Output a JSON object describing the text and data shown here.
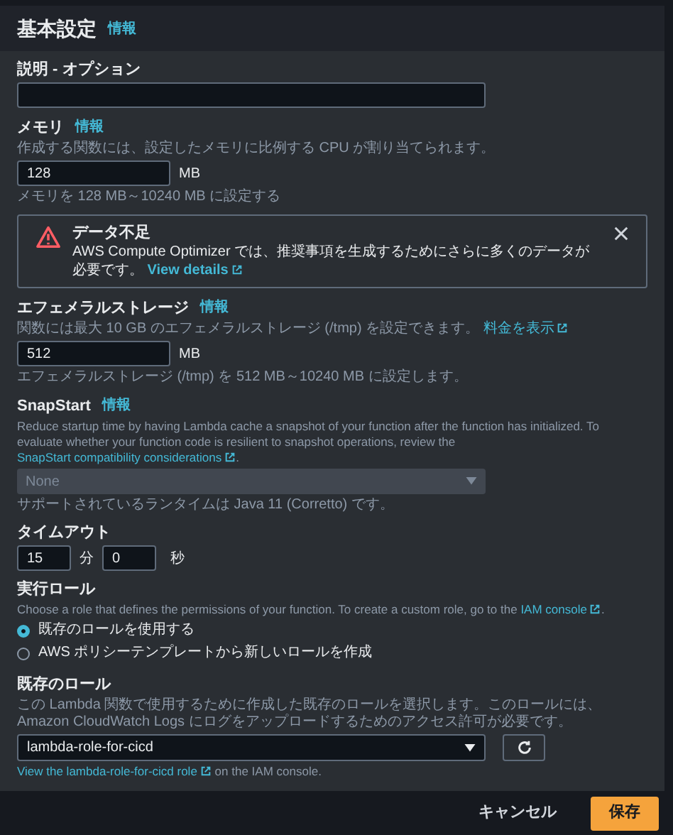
{
  "header": {
    "title": "基本設定",
    "info": "情報"
  },
  "sections": [
    {
      "kind": "text",
      "label": "説明 - オプション"
    },
    {
      "kind": "number",
      "label": "メモリ",
      "info": "情報",
      "description": "作成する関数には、設定したメモリに比例する CPU が割り当てられます。",
      "value": "128",
      "unit": "MB",
      "hint": "メモリを 128 MB～10240 MB に設定する"
    },
    {
      "kind": "alert",
      "title": "データ不足",
      "text": "AWS Compute Optimizer では、推奨事項を生成するためにさらに多くのデータが必要です。",
      "link": "View details"
    },
    {
      "kind": "number",
      "label": "エフェメラルストレージ",
      "info": "情報",
      "description": "関数には最大 10 GB のエフェメラルストレージ (/tmp) を設定できます。",
      "link": "料金を表示",
      "value": "512",
      "unit": "MB",
      "hint": "エフェメラルストレージ (/tmp) を 512 MB～10240 MB に設定します。"
    },
    {
      "kind": "select",
      "label": "SnapStart",
      "info": "情報",
      "description": "Reduce startup time by having Lambda cache a snapshot of your function after the function has initialized. To evaluate whether your function code is resilient to snapshot operations, review the",
      "link": "SnapStart compatibility considerations",
      "after": ".",
      "value": "None",
      "disabled": true,
      "hint": "サポートされているランタイムは Java 11 (Corretto) です。"
    },
    {
      "kind": "timeout",
      "label": "タイムアウト",
      "minutes": "15",
      "minutes_unit": "分",
      "seconds": "0",
      "seconds_unit": "秒"
    },
    {
      "kind": "radio",
      "label": "実行ロール",
      "description": "Choose a role that defines the permissions of your function. To create a custom role, go to the",
      "link": "IAM console",
      "after": ".",
      "options": [
        {
          "label": "既存のロールを使用する",
          "selected": true
        },
        {
          "label": "AWS ポリシーテンプレートから新しいロールを作成",
          "selected": false
        }
      ]
    },
    {
      "kind": "role",
      "label": "既存のロール",
      "description": "この Lambda 関数で使用するために作成した既存のロールを選択します。このロールには、Amazon CloudWatch Logs にログをアップロードするためのアクセス許可が必要です。",
      "value": "lambda-role-for-cicd",
      "link": "View the lambda-role-for-cicd role",
      "after": "on the IAM console."
    }
  ],
  "footer": {
    "cancel": "キャンセル",
    "save": "保存"
  }
}
